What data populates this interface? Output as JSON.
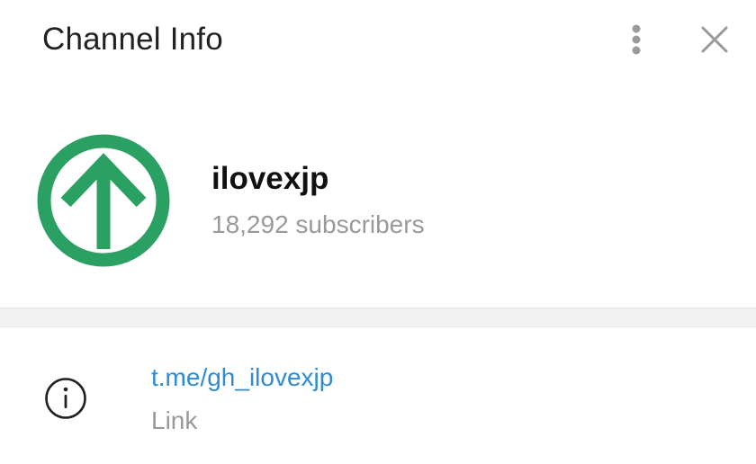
{
  "header": {
    "title": "Channel Info",
    "more_icon": "more-vertical-icon",
    "close_icon": "close-icon"
  },
  "channel": {
    "name": "ilovexjp",
    "subscribers": "18,292 subscribers",
    "avatar_icon": "up-arrow-circle-icon",
    "avatar_color": "#2aa162"
  },
  "info": {
    "icon": "info-icon",
    "link": "t.me/gh_ilovexjp",
    "link_label": "Link",
    "link_color": "#2f8bd3"
  }
}
